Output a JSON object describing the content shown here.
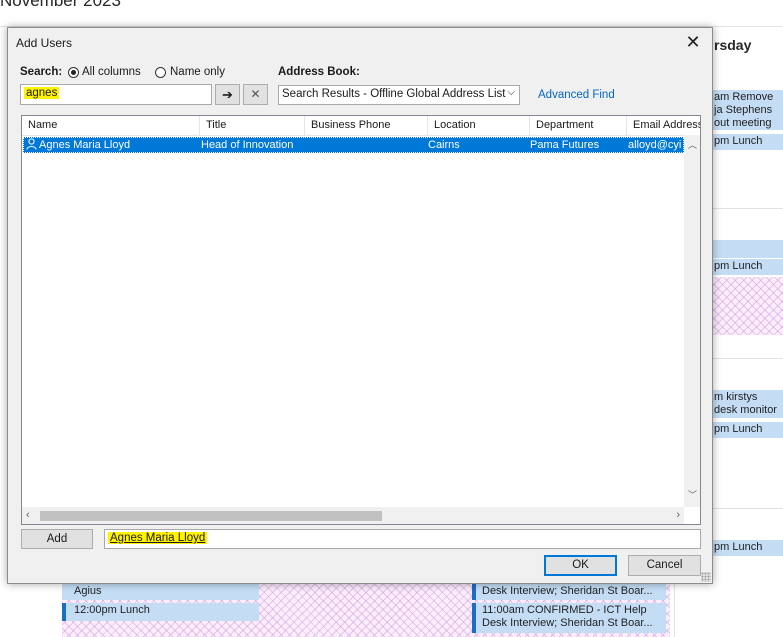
{
  "calendar": {
    "month_title": "November 2023",
    "day_header": "rsday",
    "events": [
      "am Remove ja Stephens out meeting tomo",
      "pm Lunch",
      "pm Lunch",
      "m kirstys desk monitor etc",
      "pm Lunch",
      "pm Lunch",
      "Agius",
      "12:00pm Lunch",
      "Desk Interview; Sheridan St Boar...",
      "11:00am CONFIRMED - ICT Help Desk Interview; Sheridan St Boar..."
    ]
  },
  "dialog": {
    "title": "Add Users",
    "close_glyph": "✕",
    "search_label": "Search:",
    "radio_all": "All columns",
    "radio_name": "Name only",
    "search_value": "agnes",
    "go_glyph": "➔",
    "clear_glyph": "✕",
    "address_book_label": "Address Book:",
    "address_book_value": "Search Results - Offline Global Address List",
    "advanced_find": "Advanced Find",
    "columns": [
      "Name",
      "Title",
      "Business Phone",
      "Location",
      "Department",
      "Email Address"
    ],
    "rows": [
      {
        "name": "Agnes Maria Lloyd",
        "title": "Head of Innovation",
        "phone": "",
        "location": "Cairns",
        "department": "Pama Futures",
        "email": "alloyd@cyi"
      }
    ],
    "add_button": "Add",
    "added_value": "Agnes Maria Lloyd",
    "ok_button": "OK",
    "cancel_button": "Cancel"
  }
}
